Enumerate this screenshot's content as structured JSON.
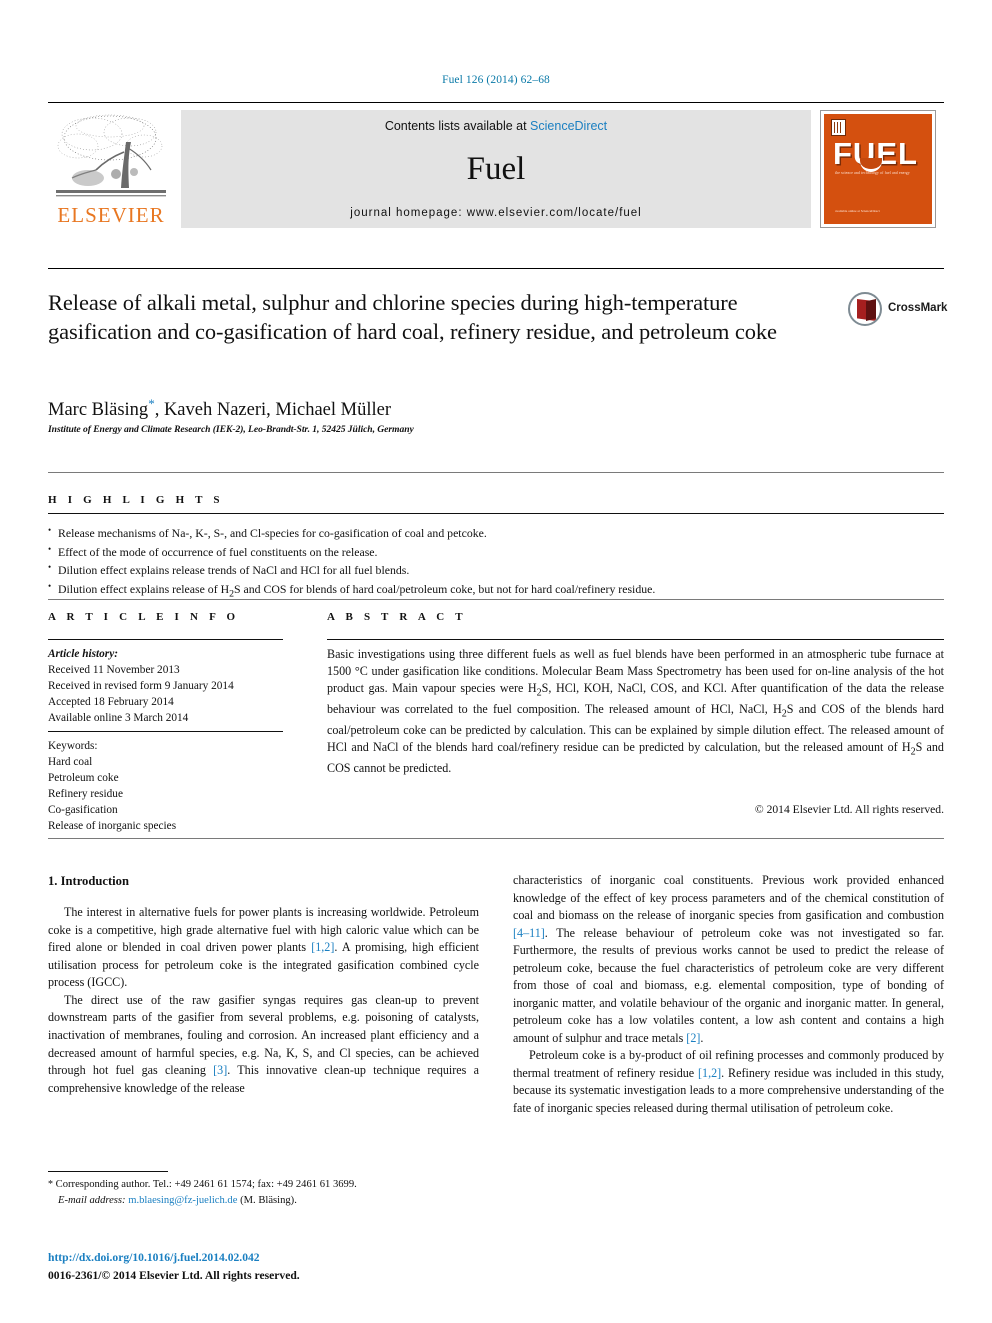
{
  "running_head": "Fuel 126 (2014) 62–68",
  "banner": {
    "contents_prefix": "Contents lists available at ",
    "sciencedirect": "ScienceDirect",
    "journal_name": "Fuel",
    "homepage": "journal homepage: www.elsevier.com/locate/fuel",
    "publisher_logo_text": "ELSEVIER",
    "cover_title": "FUEL",
    "cover_subtitle": "the science and technology of fuel and energy",
    "cover_footer": "available online at\nScienceDirect"
  },
  "article": {
    "title": "Release of alkali metal, sulphur and chlorine species during high-temperature gasification and co-gasification of hard coal, refinery residue, and petroleum coke",
    "crossmark_label": "CrossMark",
    "authors": "Marc Bläsing",
    "authors_rest": ", Kaveh Nazeri, Michael Müller",
    "corresponding_marker": "*",
    "affiliation": "Institute of Energy and Climate Research (IEK-2), Leo-Brandt-Str. 1, 52425 Jülich, Germany"
  },
  "highlights": {
    "heading": "H I G H L I G H T S",
    "items": [
      "Release mechanisms of Na-, K-, S-, and Cl-species for co-gasification of coal and petcoke.",
      "Effect of the mode of occurrence of fuel constituents on the release.",
      "Dilution effect explains release trends of NaCl and HCl for all fuel blends.",
      "Dilution effect explains release of H2S and COS for blends of hard coal/petroleum coke, but not for hard coal/refinery residue."
    ]
  },
  "article_info": {
    "heading": "A R T I C L E   I N F O",
    "history_label": "Article history:",
    "history": [
      "Received 11 November 2013",
      "Received in revised form 9 January 2014",
      "Accepted 18 February 2014",
      "Available online 3 March 2014"
    ],
    "keywords_label": "Keywords:",
    "keywords": [
      "Hard coal",
      "Petroleum coke",
      "Refinery residue",
      "Co-gasification",
      "Release of inorganic species"
    ]
  },
  "abstract": {
    "heading": "A B S T R A C T",
    "text": "Basic investigations using three different fuels as well as fuel blends have been performed in an atmospheric tube furnace at 1500 °C under gasification like conditions. Molecular Beam Mass Spectrometry has been used for on-line analysis of the hot product gas. Main vapour species were H2S, HCl, KOH, NaCl, COS, and KCl. After quantification of the data the release behaviour was correlated to the fuel composition. The released amount of HCl, NaCl, H2S and COS of the blends hard coal/petroleum coke can be predicted by calculation. This can be explained by simple dilution effect. The released amount of HCl and NaCl of the blends hard coal/refinery residue can be predicted by calculation, but the released amount of H2S and COS cannot be predicted.",
    "copyright": "© 2014 Elsevier Ltd. All rights reserved."
  },
  "body": {
    "section_title": "1. Introduction",
    "left_paragraph_1_a": "The interest in alternative fuels for power plants is increasing worldwide. Petroleum coke is a competitive, high grade alternative fuel with high caloric value which can be fired alone or blended in coal driven power plants ",
    "left_ref_1": "[1,2]",
    "left_paragraph_1_b": ". A promising, high efficient utilisation process for petroleum coke is the integrated gasification combined cycle process (IGCC).",
    "left_paragraph_2_a": "The direct use of the raw gasifier syngas requires gas clean-up to prevent downstream parts of the gasifier from several problems, e.g. poisoning of catalysts, inactivation of membranes, fouling and corrosion. An increased plant efficiency and a decreased amount of harmful species, e.g. Na, K, S, and Cl species, can be achieved through hot fuel gas cleaning ",
    "left_ref_2": "[3]",
    "left_paragraph_2_b": ". This innovative clean-up technique requires a comprehensive knowledge of the release",
    "right_paragraph_1_a": "characteristics of inorganic coal constituents. Previous work provided enhanced knowledge of the effect of key process parameters and of the chemical constitution of coal and biomass on the release of inorganic species from gasification and combustion ",
    "right_ref_1": "[4–11]",
    "right_paragraph_1_b": ". The release behaviour of petroleum coke was not investigated so far. Furthermore, the results of previous works cannot be used to predict the release of petroleum coke, because the fuel characteristics of petroleum coke are very different from those of coal and biomass, e.g. elemental composition, type of bonding of inorganic matter, and volatile behaviour of the organic and inorganic matter. In general, petroleum coke has a low volatiles content, a low ash content and contains a high amount of sulphur and trace metals ",
    "right_ref_2": "[2]",
    "right_paragraph_1_c": ".",
    "right_paragraph_2_a": "Petroleum coke is a by-product of oil refining processes and commonly produced by thermal treatment of refinery residue ",
    "right_ref_3": "[1,2]",
    "right_paragraph_2_b": ". Refinery residue was included in this study, because its systematic investigation leads to a more comprehensive understanding of the fate of inorganic species released during thermal utilisation of petroleum coke."
  },
  "footer": {
    "corresponding_marker": "*",
    "corresponding_text": " Corresponding author. Tel.: +49 2461 61 1574; fax: +49 2461 61 3699.",
    "email_label": "E-mail address:",
    "email": "m.blaesing@fz-juelich.de",
    "email_author": " (M. Bläsing).",
    "doi": "http://dx.doi.org/10.1016/j.fuel.2014.02.042",
    "issn_line": "0016-2361/© 2014 Elsevier Ltd. All rights reserved."
  },
  "colors": {
    "link": "#1a7fc1",
    "elsevier_orange": "#E87722",
    "cover_orange": "#d4500f"
  }
}
